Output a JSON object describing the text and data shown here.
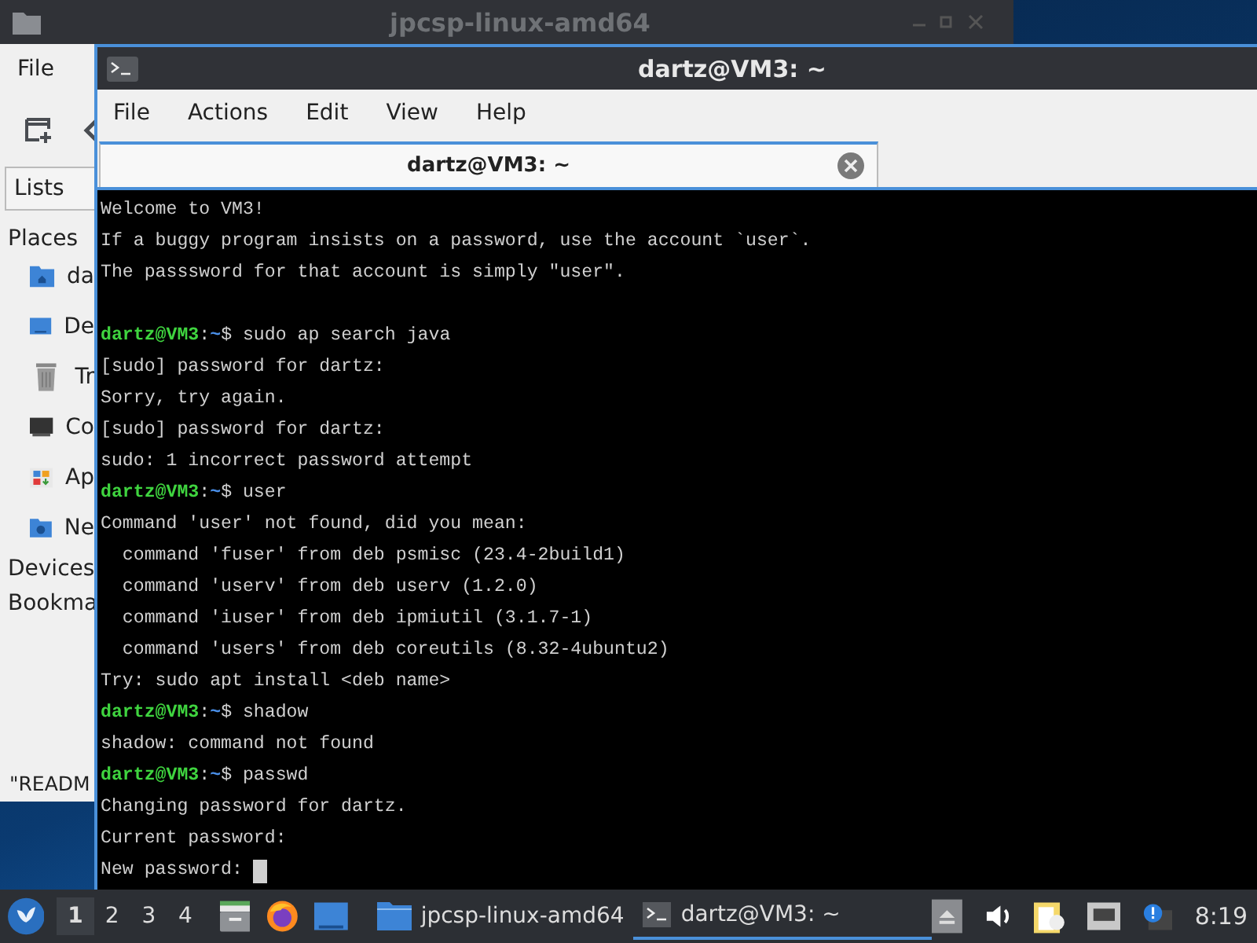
{
  "file_manager": {
    "title": "jpcsp-linux-amd64",
    "menu": [
      "File"
    ],
    "view_button": "Lists",
    "places_heading": "Places",
    "places": [
      {
        "label": "da"
      },
      {
        "label": "De"
      },
      {
        "label": "Tr"
      },
      {
        "label": "Co"
      },
      {
        "label": "Ap"
      },
      {
        "label": "Ne"
      }
    ],
    "devices_heading": "Devices",
    "bookmarks_heading": "Bookma",
    "status": "\"READM"
  },
  "terminal": {
    "title": "dartz@VM3: ~",
    "menu": [
      "File",
      "Actions",
      "Edit",
      "View",
      "Help"
    ],
    "tabs": [
      {
        "label": "dartz@VM3: ~",
        "selected": true
      }
    ],
    "cursor": true,
    "lines": [
      {
        "kind": "output",
        "text": "Welcome to VM3!"
      },
      {
        "kind": "output",
        "text": "If a buggy program insists on a password, use the account `user`."
      },
      {
        "kind": "output",
        "text": "The passsword for that account is simply \"user\"."
      },
      {
        "kind": "blank"
      },
      {
        "kind": "prompt",
        "user": "dartz@VM3",
        "sep": ":",
        "path": "~",
        "command": "$ sudo ap search java"
      },
      {
        "kind": "output",
        "text": "[sudo] password for dartz:"
      },
      {
        "kind": "output",
        "text": "Sorry, try again."
      },
      {
        "kind": "output",
        "text": "[sudo] password for dartz:"
      },
      {
        "kind": "output",
        "text": "sudo: 1 incorrect password attempt"
      },
      {
        "kind": "prompt",
        "user": "dartz@VM3",
        "sep": ":",
        "path": "~",
        "command": "$ user"
      },
      {
        "kind": "output",
        "text": "Command 'user' not found, did you mean:"
      },
      {
        "kind": "output",
        "text": "  command 'fuser' from deb psmisc (23.4-2build1)"
      },
      {
        "kind": "output",
        "text": "  command 'userv' from deb userv (1.2.0)"
      },
      {
        "kind": "output",
        "text": "  command 'iuser' from deb ipmiutil (3.1.7-1)"
      },
      {
        "kind": "output",
        "text": "  command 'users' from deb coreutils (8.32-4ubuntu2)"
      },
      {
        "kind": "output",
        "text": "Try: sudo apt install <deb name>"
      },
      {
        "kind": "prompt",
        "user": "dartz@VM3",
        "sep": ":",
        "path": "~",
        "command": "$ shadow"
      },
      {
        "kind": "output",
        "text": "shadow: command not found"
      },
      {
        "kind": "prompt",
        "user": "dartz@VM3",
        "sep": ":",
        "path": "~",
        "command": "$ passwd"
      },
      {
        "kind": "output",
        "text": "Changing password for dartz."
      },
      {
        "kind": "output",
        "text": "Current password:"
      },
      {
        "kind": "output",
        "text": "New password: "
      }
    ]
  },
  "taskbar": {
    "workspaces": [
      {
        "label": "1",
        "selected": true
      },
      {
        "label": "2",
        "selected": false
      },
      {
        "label": "3",
        "selected": false
      },
      {
        "label": "4",
        "selected": false
      }
    ],
    "tasks": [
      {
        "label": "jpcsp-linux-amd64",
        "selected": false
      },
      {
        "label": "dartz@VM3: ~",
        "selected": true
      }
    ],
    "clock": "8:19"
  }
}
